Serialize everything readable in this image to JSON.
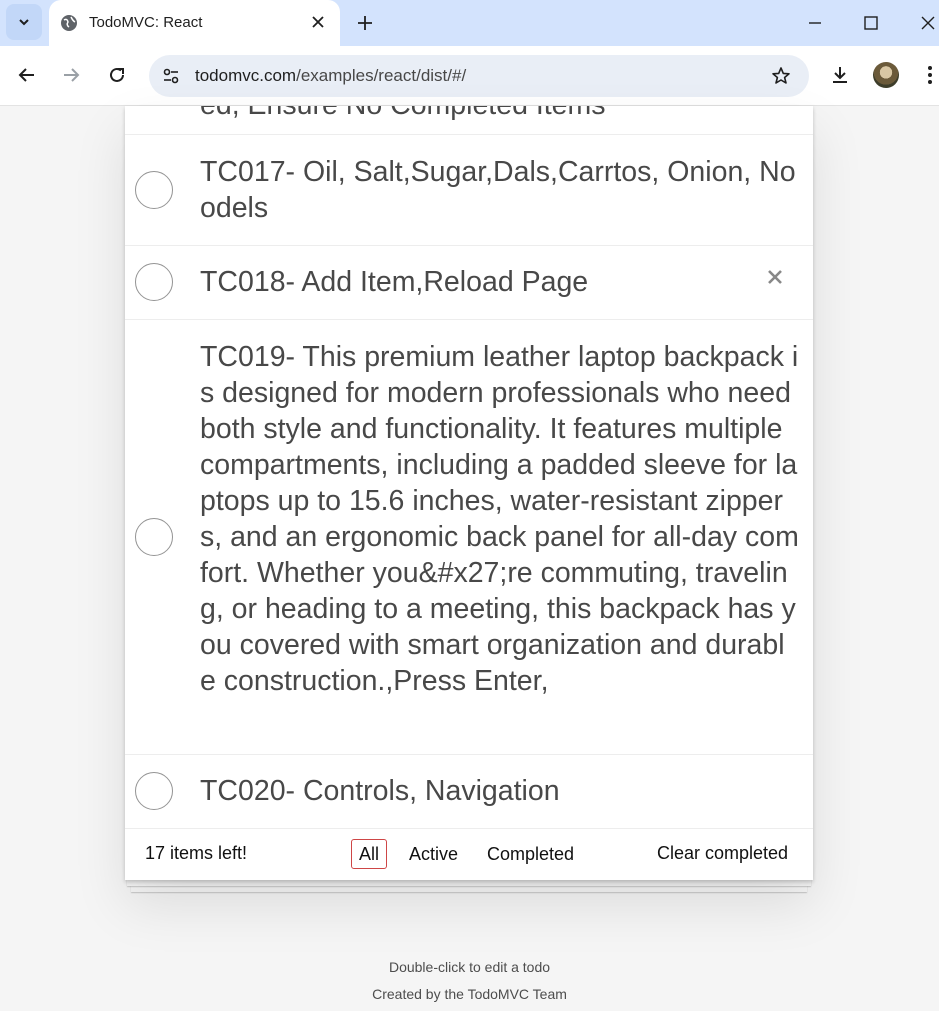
{
  "browser": {
    "tab_title": "TodoMVC: React",
    "url_host": "todomvc.com",
    "url_path": "/examples/react/dist/#/",
    "icons": [
      "tab-search-icon",
      "globe-icon",
      "close-icon",
      "plus-icon",
      "minimize-icon",
      "maximize-icon",
      "close-window-icon",
      "back-arrow-icon",
      "forward-arrow-icon",
      "reload-icon",
      "site-info-icon",
      "star-icon",
      "download-icon",
      "menu-dots-icon"
    ]
  },
  "todos": [
    {
      "label": "ed, Ensure No Completed Items",
      "completed": false
    },
    {
      "label": "TC017- Oil, Salt,Sugar,Dals,Carrtos, Onion, Noodels",
      "completed": false
    },
    {
      "label": "TC018- Add Item,Reload Page",
      "completed": false
    },
    {
      "label": "TC019- This premium leather laptop backpack is designed for modern professionals who need both style and functionality. It features multiple compartments, including a padded sleeve for laptops up to 15.6 inches, water-resistant zippers, and an ergonomic back panel for all-day comfort. Whether you&#x27;re commuting, traveling, or heading to a meeting, this backpack has you covered with smart organization and durable construction.,Press Enter,",
      "completed": false
    },
    {
      "label": "TC020- Controls, Navigation",
      "completed": false
    }
  ],
  "footer": {
    "count": "17 items left!",
    "filters": [
      "All",
      "Active",
      "Completed"
    ],
    "selected_filter": "All",
    "clear_completed": "Clear completed"
  },
  "info": {
    "edit_hint": "Double-click to edit a todo",
    "credits": "Created by the TodoMVC Team"
  },
  "colors": {
    "accent_selected_filter": "#ce4646",
    "tabbar": "#d3e3fd"
  }
}
